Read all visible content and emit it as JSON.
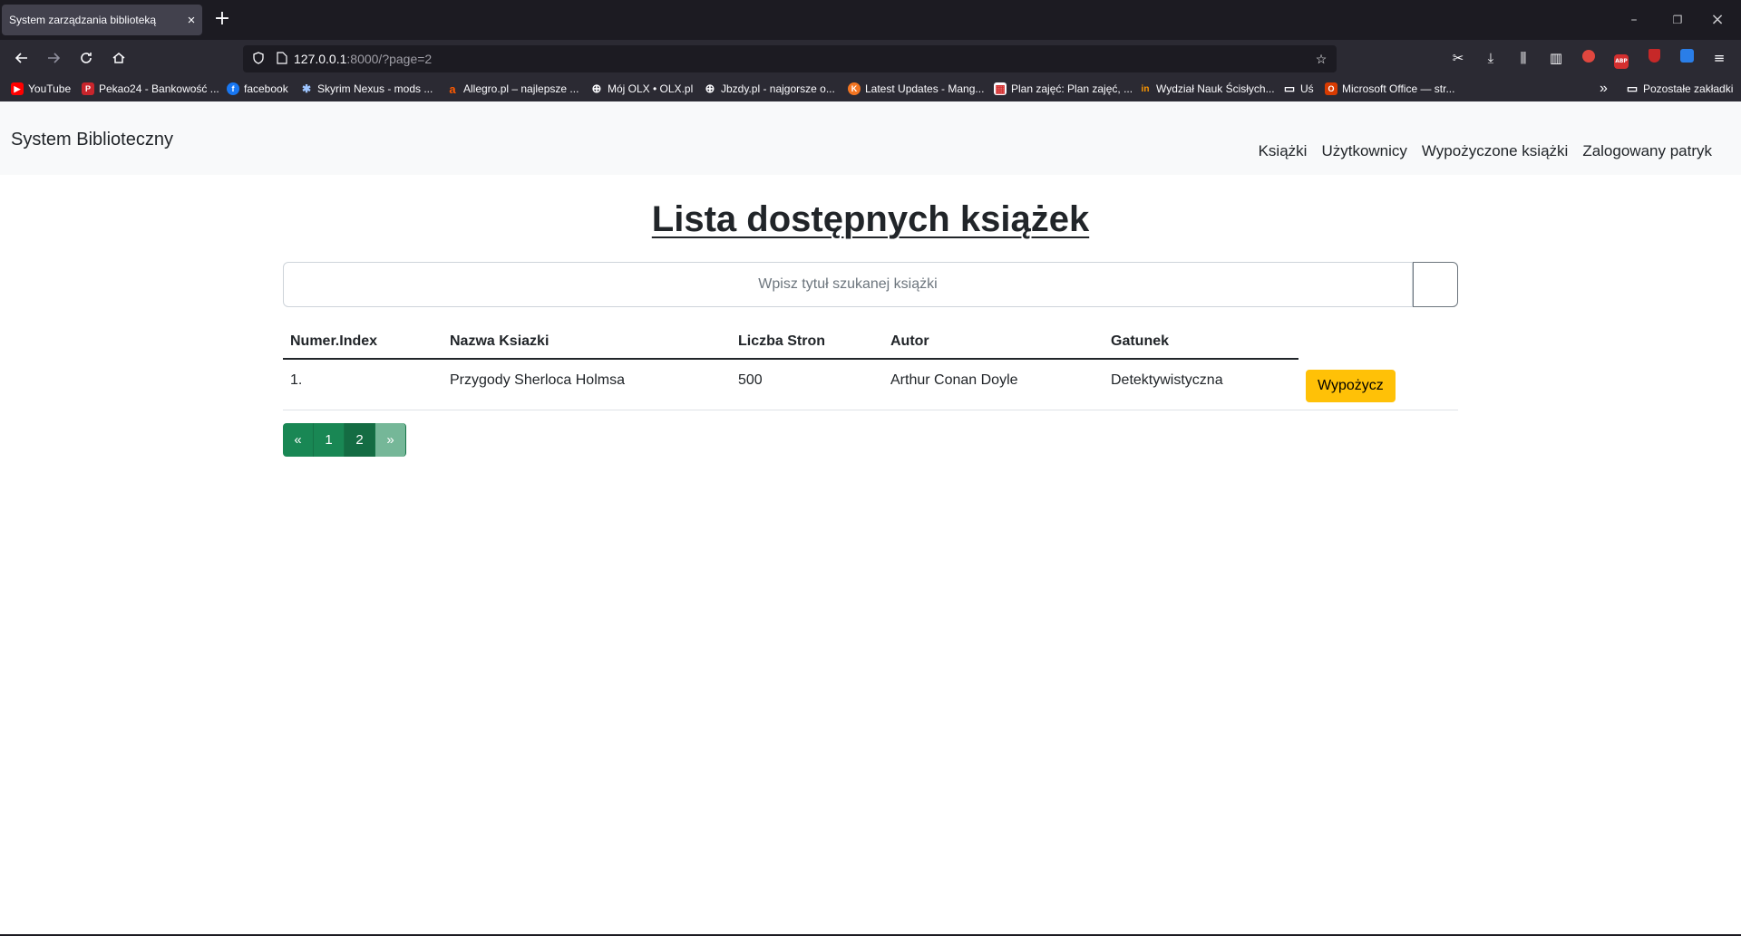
{
  "browser": {
    "tab_title": "System zarządzania biblioteką",
    "tab_close": "×",
    "new_tab": "+",
    "url_host": "127.0.0.1",
    "url_rest": ":8000/?page=2",
    "window_controls": {
      "minimize": "–",
      "restore": "❐",
      "close": "×"
    },
    "bookmarks": [
      {
        "label": "YouTube",
        "icon": "youtube-icon",
        "color": "#ff0000",
        "glyph": "▶"
      },
      {
        "label": "Pekao24 - Bankowość ...",
        "icon": "pekao-icon",
        "color": "#c9252c",
        "glyph": "P"
      },
      {
        "label": "facebook",
        "icon": "facebook-icon",
        "color": "#1877f2",
        "glyph": "f"
      },
      {
        "label": "Skyrim Nexus - mods ...",
        "icon": "nexus-icon",
        "color": "#d98f40",
        "glyph": "✱"
      },
      {
        "label": "Allegro.pl – najlepsze ...",
        "icon": "allegro-icon",
        "color": "#ff5a00",
        "glyph": "a"
      },
      {
        "label": "Mój OLX • OLX.pl",
        "icon": "globe-icon",
        "color": "#2b2a33",
        "glyph": "⊕"
      },
      {
        "label": "Jbzdy.pl - najgorsze o...",
        "icon": "globe-icon",
        "color": "#2b2a33",
        "glyph": "⊕"
      },
      {
        "label": "Latest Updates - Mang...",
        "icon": "manga-icon",
        "color": "#f47521",
        "glyph": "K"
      },
      {
        "label": "Plan zajęć: Plan zajęć, ...",
        "icon": "plan-icon",
        "color": "#d32f2f",
        "glyph": "▦"
      },
      {
        "label": "Wydział Nauk Ścisłych...",
        "icon": "wns-icon",
        "color": "#ff9800",
        "glyph": "in"
      },
      {
        "label": "Uś",
        "icon": "folder-icon",
        "color": "#2b2a33",
        "glyph": "▭"
      },
      {
        "label": "Microsoft Office — str...",
        "icon": "office-icon",
        "color": "#d83b01",
        "glyph": "O"
      }
    ],
    "bookmarks_more": "»",
    "other_bookmarks": "Pozostałe zakładki"
  },
  "site": {
    "brand": "System Biblioteczny",
    "nav": {
      "books": "Książki",
      "users": "Użytkownicy",
      "borrowed": "Wypożyczone książki",
      "logged_in": "Zalogowany patryk"
    },
    "title": "Lista dostępnych książek",
    "search": {
      "placeholder": "Wpisz tytuł szukanej książki",
      "value": ""
    },
    "table": {
      "headers": {
        "index": "Numer.Index",
        "name": "Nazwa Ksiazki",
        "pages": "Liczba Stron",
        "author": "Autor",
        "genre": "Gatunek"
      },
      "rows": [
        {
          "index": "1.",
          "name": "Przygody Sherloca Holmsa",
          "pages": "500",
          "author": "Arthur Conan Doyle",
          "genre": "Detektywistyczna",
          "action": "Wypożycz"
        }
      ]
    },
    "pagination": {
      "prev": "«",
      "page1": "1",
      "page2": "2",
      "next": "»",
      "current": 2
    }
  },
  "colors": {
    "borrow_button": "#ffc107",
    "pagination": "#198754",
    "pagination_active": "#146c43",
    "pagination_disabled": "#75b798"
  }
}
